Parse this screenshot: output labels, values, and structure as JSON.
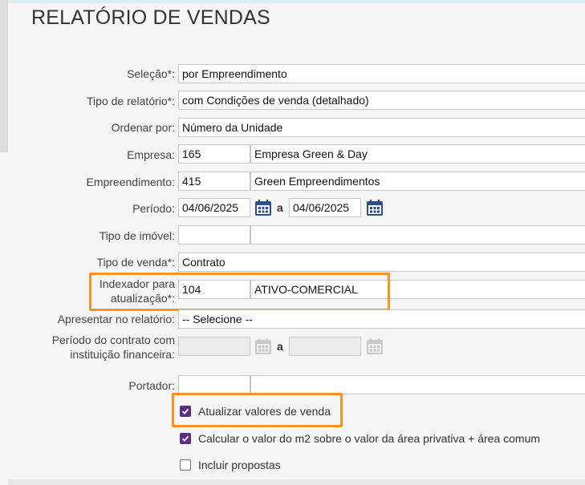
{
  "title": "RELATÓRIO DE VENDAS",
  "fields": {
    "selecao": {
      "label": "Seleção*",
      "value": "por Empreendimento"
    },
    "tipo_relatorio": {
      "label": "Tipo de relatório*",
      "value": "com Condições de venda (detalhado)"
    },
    "ordenar_por": {
      "label": "Ordenar por",
      "value": "Número da Unidade"
    },
    "empresa": {
      "label": "Empresa",
      "code": "165",
      "name": "Empresa Green & Day"
    },
    "empreendimento": {
      "label": "Empreendimento",
      "code": "415",
      "name": "Green Empreendimentos"
    },
    "periodo": {
      "label": "Período",
      "start": "04/06/2025",
      "separator": "a",
      "end": "04/06/2025"
    },
    "tipo_imovel": {
      "label": "Tipo de imóvel",
      "code": "",
      "name": ""
    },
    "tipo_venda": {
      "label": "Tipo de venda*",
      "value": "Contrato"
    },
    "indexador": {
      "label_line1": "Indexador para",
      "label_line2": "atualização*",
      "code": "104",
      "name": "ATIVO-COMERCIAL"
    },
    "apresentar": {
      "label": "Apresentar no relatório",
      "value": "-- Selecione --"
    },
    "periodo_contrato": {
      "label_line1": "Período do contrato com",
      "label_line2": "instituição financeira",
      "start": "",
      "separator": "a",
      "end": ""
    },
    "portador": {
      "label": "Portador",
      "code": "",
      "name": ""
    }
  },
  "checkboxes": [
    {
      "label": "Atualizar valores de venda",
      "checked": true
    },
    {
      "label": "Calcular o valor do m2 sobre o valor da área privativa + área comum",
      "checked": true
    },
    {
      "label": "Incluir propostas",
      "checked": false
    }
  ],
  "colors": {
    "accent": "#5c2d82",
    "highlight": "#f7931e",
    "calendar": "#2a4f8f"
  }
}
